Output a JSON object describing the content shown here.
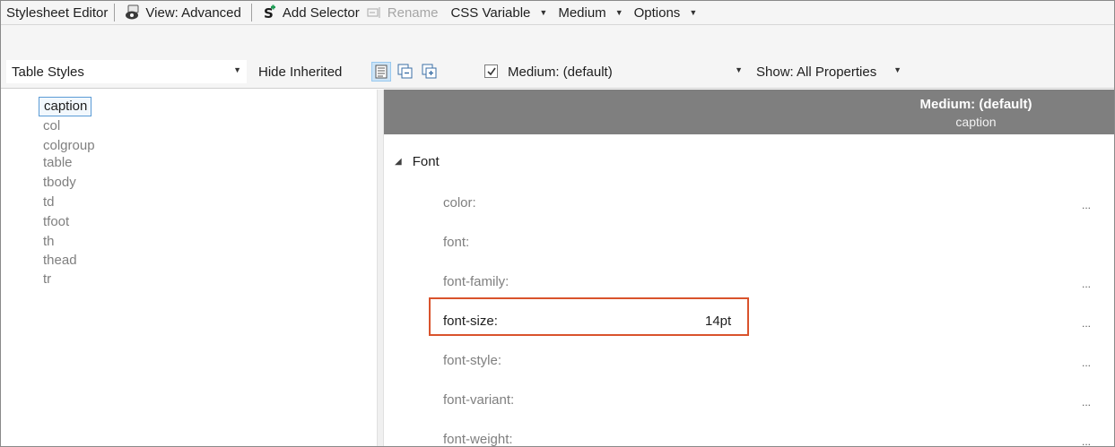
{
  "toolbar": {
    "title": "Stylesheet Editor",
    "view_label": "View: Advanced",
    "add_selector_label": "Add Selector",
    "rename_label": "Rename",
    "css_variable_label": "CSS Variable",
    "medium_label": "Medium",
    "options_label": "Options"
  },
  "filters": {
    "stylesheet_select": "Table Styles",
    "hide_inherited_label": "Hide Inherited",
    "medium_select": "Medium: (default)",
    "medium_checked": true,
    "show_select": "Show: All Properties"
  },
  "selectors": {
    "items": [
      "caption",
      "col",
      "colgroup",
      "table",
      "tbody",
      "td",
      "tfoot",
      "th",
      "thead",
      "tr"
    ],
    "selected": "caption"
  },
  "properties": {
    "header_medium": "Medium: (default)",
    "header_selector": "caption",
    "group_label": "Font",
    "rows": [
      {
        "name": "color:",
        "value": "",
        "more": "..."
      },
      {
        "name": "font:",
        "value": "",
        "more": ""
      },
      {
        "name": "font-family:",
        "value": "",
        "more": "..."
      },
      {
        "name": "font-size:",
        "value": "14pt",
        "more": "..."
      },
      {
        "name": "font-style:",
        "value": "",
        "more": "..."
      },
      {
        "name": "font-variant:",
        "value": "",
        "more": "..."
      },
      {
        "name": "font-weight:",
        "value": "",
        "more": "..."
      }
    ]
  },
  "colors": {
    "accent_green": "#1f9d55",
    "header_gray": "#7f7f7f",
    "highlight_red": "#d9532c",
    "selection_blue": "#5b9bd5"
  },
  "icons": [
    "eye-icon",
    "add-selector-icon",
    "rename-icon",
    "list-view-icon",
    "collapse-all-icon",
    "expand-all-icon",
    "checkbox-icon",
    "dropdown-caret-icon",
    "collapse-triangle-icon",
    "ellipsis-icon"
  ]
}
